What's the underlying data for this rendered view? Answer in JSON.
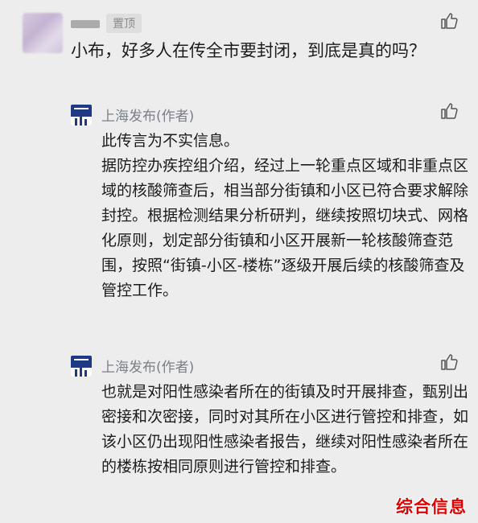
{
  "top_comment": {
    "pin_label": "置顶",
    "text": "小布，好多人在传全市要封闭，到底是真的吗？"
  },
  "replies": [
    {
      "author": "上海发布(作者)",
      "paragraphs": [
        "此传言为不实信息。",
        "据防控办疾控组介绍，经过上一轮重点区域和非重点区域的核酸筛查后，相当部分街镇和小区已符合要求解除封控。根据检测结果分析研判，继续按照切块式、网格化原则，划定部分街镇和小区开展新一轮核酸筛查范围，按照“街镇-小区-楼栋”逐级开展后续的核酸筛查及管控工作。"
      ]
    },
    {
      "author": "上海发布(作者)",
      "paragraphs": [
        "也就是对阳性感染者所在的街镇及时开展排查，甄别出密接和次密接，同时对其所在小区进行管控和排查，如该小区仍出现阳性感染者报告，继续对阳性感染者所在的楼栋按相同原则进行管控和排查。"
      ]
    }
  ],
  "watermark": "综合信息",
  "icons": {
    "like": "thumbs-up-icon",
    "logo": "shanghai-fabu-logo"
  },
  "colors": {
    "background": "#ededed",
    "name_gray": "#7b8088",
    "logo_blue": "#1f3a82",
    "watermark_red": "#e10000"
  }
}
